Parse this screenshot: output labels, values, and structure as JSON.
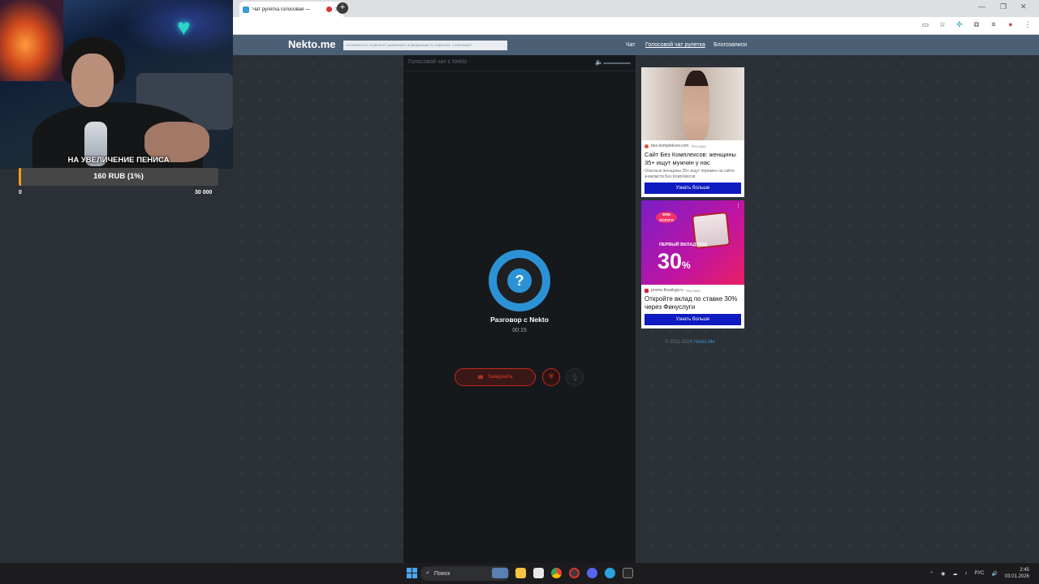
{
  "browser": {
    "tab_title": "Чат рулетка голосовая — ",
    "tab_close": "✕",
    "new_tab": "+",
    "window_controls": [
      "—",
      "❐",
      "✕"
    ],
    "toolbar_icons": [
      "cast-icon",
      "star-icon",
      "extension-icon",
      "puzzle-icon",
      "menu-icon",
      "profile-icon",
      "more-icon"
    ]
  },
  "site": {
    "logo": "Nekto.me",
    "notice": "Анонимность позволяет размещать информацию в открытом, с кем видят",
    "nav": [
      "Чат",
      "Голосовой чат рулетка",
      "Блогозаписи"
    ]
  },
  "chat": {
    "title": "Голосовой чат с Nekto",
    "avatar_symbol": "?",
    "conversation_title": "Разговор с Nekto",
    "timer": "00:15",
    "end_button": "Завершить",
    "end_icon": "☎",
    "shield_icon": "⛨",
    "mic_icon": "🎙"
  },
  "ads": [
    {
      "source": "bez-kompleksov.com",
      "tag": "Реклама",
      "headline": "Сайт Без Комплексов: женщины 35+ ищут мужчин у нас",
      "description": "Опытные женщины 35+ ищут перемен на сайте знакомств Без Комплексов",
      "button": "Узнать больше"
    },
    {
      "source": "promo.finuslugi.ru",
      "tag": "Реклама",
      "badge": "ФИН УСЛУГИ",
      "promo_line": "ПЕРВЫЙ ВКЛАД ПОД",
      "promo_value": "30",
      "promo_unit": "%",
      "headline": "Откройте вклад по ставке 30% через Финуслуги",
      "button": "Узнать больше"
    }
  ],
  "footer": {
    "copyright": "© 2011-2026",
    "link": "Nekto.Me"
  },
  "stream_overlay": {
    "donation_title": "НА УВЕЛИЧЕНИЕ ПЕНИСА",
    "progress_label": "160 RUB (1%)",
    "progress_fraction": 0.01,
    "min": "0",
    "max": "30 000",
    "accent_color": "#f29a1e"
  },
  "taskbar": {
    "search_placeholder": "Поиск",
    "language": "РУС",
    "time": "2:45",
    "date": "03.01.2026"
  }
}
